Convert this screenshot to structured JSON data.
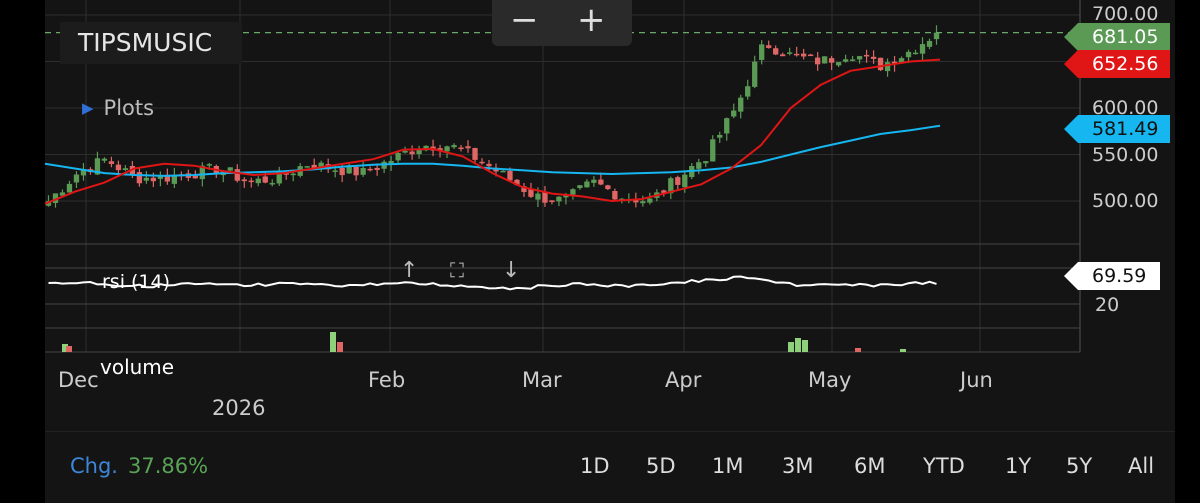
{
  "ticker": "TIPSMUSIC",
  "plots_label": "Plots",
  "zoom": {
    "minus": "−",
    "plus": "+"
  },
  "price_axis": [
    "700.00",
    "650.00",
    "600.00",
    "550.00",
    "500.00"
  ],
  "tags": {
    "last": "681.05",
    "ma_short": "652.56",
    "ma_long": "581.49",
    "rsi": "69.59"
  },
  "rsi_label": "rsi (14)",
  "rsi_axis": "20",
  "volume_label": "volume",
  "x_labels": {
    "year": "2026",
    "months": [
      "Dec",
      "Feb",
      "Mar",
      "Apr",
      "May",
      "Jun"
    ]
  },
  "change": {
    "label": "Chg.",
    "value": "37.86%"
  },
  "ranges": [
    "1D",
    "5D",
    "1M",
    "3M",
    "6M",
    "YTD",
    "1Y",
    "5Y",
    "All"
  ],
  "colors": {
    "up": "#5a9a55",
    "down": "#e06666",
    "ma_short": "#e01515",
    "ma_long": "#16b6f0",
    "rsi": "#ffffff",
    "change": "#5aa356"
  },
  "chart_data": {
    "type": "candlestick",
    "title": "TIPSMUSIC",
    "price_range": [
      470,
      708
    ],
    "price_ticks": [
      500,
      550,
      600,
      650,
      700
    ],
    "last_price": 681.05,
    "x_tick_labels": [
      "Dec",
      "2026",
      "Feb",
      "Mar",
      "Apr",
      "May",
      "Jun"
    ],
    "series": [
      {
        "name": "price",
        "close_approx_weekly": [
          500,
          530,
          545,
          525,
          525,
          530,
          535,
          520,
          525,
          540,
          535,
          530,
          545,
          560,
          560,
          545,
          525,
          505,
          500,
          520,
          505,
          500,
          525,
          550,
          600,
          670,
          655,
          650,
          660,
          645,
          660,
          681
        ]
      },
      {
        "name": "ma_short",
        "last": 652.56,
        "values_approx": [
          497,
          510,
          520,
          535,
          540,
          538,
          532,
          528,
          530,
          535,
          540,
          545,
          555,
          556,
          548,
          530,
          515,
          508,
          505,
          500,
          502,
          510,
          518,
          535,
          560,
          600,
          625,
          640,
          645,
          650,
          652
        ]
      },
      {
        "name": "ma_long",
        "last": 581.49,
        "values_approx": [
          540,
          535,
          530,
          528,
          527,
          528,
          530,
          531,
          532,
          534,
          537,
          539,
          540,
          540,
          538,
          535,
          533,
          531,
          530,
          529,
          530,
          531,
          533,
          536,
          542,
          550,
          558,
          565,
          572,
          576,
          581
        ]
      },
      {
        "name": "rsi (14)",
        "last": 69.59
      }
    ],
    "volume_highlights": [
      "early Jan spike",
      "late Apr spike",
      "mid May small"
    ]
  }
}
